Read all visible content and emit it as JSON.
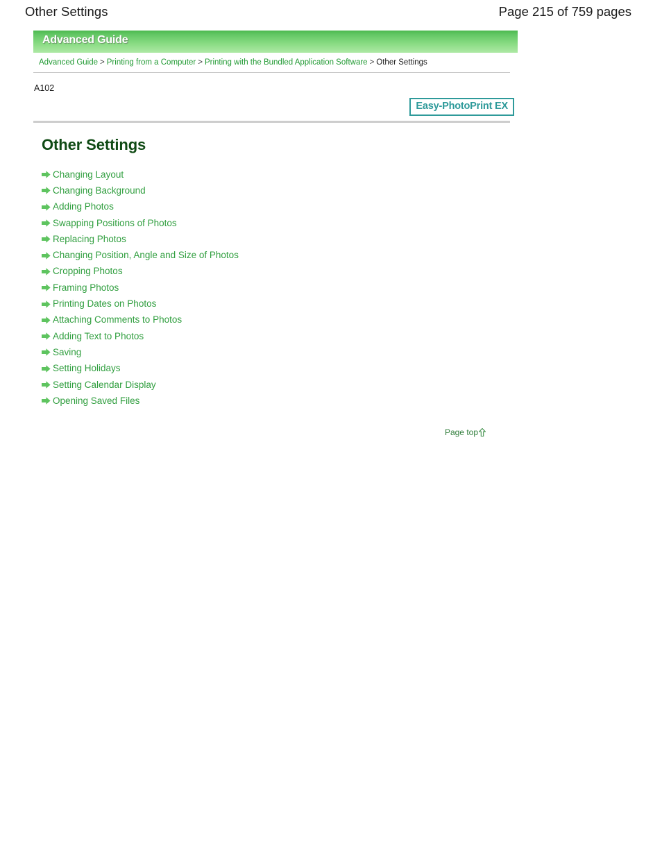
{
  "page_header": {
    "doc_title": "Other Settings",
    "page_count": "Page 215 of 759 pages"
  },
  "guide_banner": {
    "label": "Advanced Guide"
  },
  "breadcrumb": {
    "separator": ">",
    "items": [
      {
        "label": "Advanced Guide",
        "current": false
      },
      {
        "label": "Printing from a Computer",
        "current": false
      },
      {
        "label": "Printing with the Bundled Application Software",
        "current": false
      },
      {
        "label": "Other Settings",
        "current": true
      }
    ]
  },
  "doc_code": "A102",
  "product_badge": {
    "label": "Easy-PhotoPrint EX",
    "border_color": "#2e9a9a",
    "text_color": "#2e9a9a"
  },
  "section": {
    "heading": "Other Settings",
    "heading_color": "#0f4a14"
  },
  "link_list": {
    "icon": "arrow-right-icon",
    "link_color": "#2f9e3e",
    "items": [
      {
        "label": "Changing Layout"
      },
      {
        "label": "Changing Background"
      },
      {
        "label": "Adding Photos"
      },
      {
        "label": "Swapping Positions of Photos"
      },
      {
        "label": "Replacing Photos"
      },
      {
        "label": "Changing Position, Angle and Size of Photos"
      },
      {
        "label": "Cropping Photos"
      },
      {
        "label": "Framing Photos"
      },
      {
        "label": "Printing Dates on Photos"
      },
      {
        "label": "Attaching Comments to Photos"
      },
      {
        "label": "Adding Text to Photos"
      },
      {
        "label": "Saving"
      },
      {
        "label": "Setting Holidays"
      },
      {
        "label": "Setting Calendar Display"
      },
      {
        "label": "Opening Saved Files"
      }
    ]
  },
  "page_top": {
    "label": "Page top",
    "icon": "arrow-up-icon"
  }
}
